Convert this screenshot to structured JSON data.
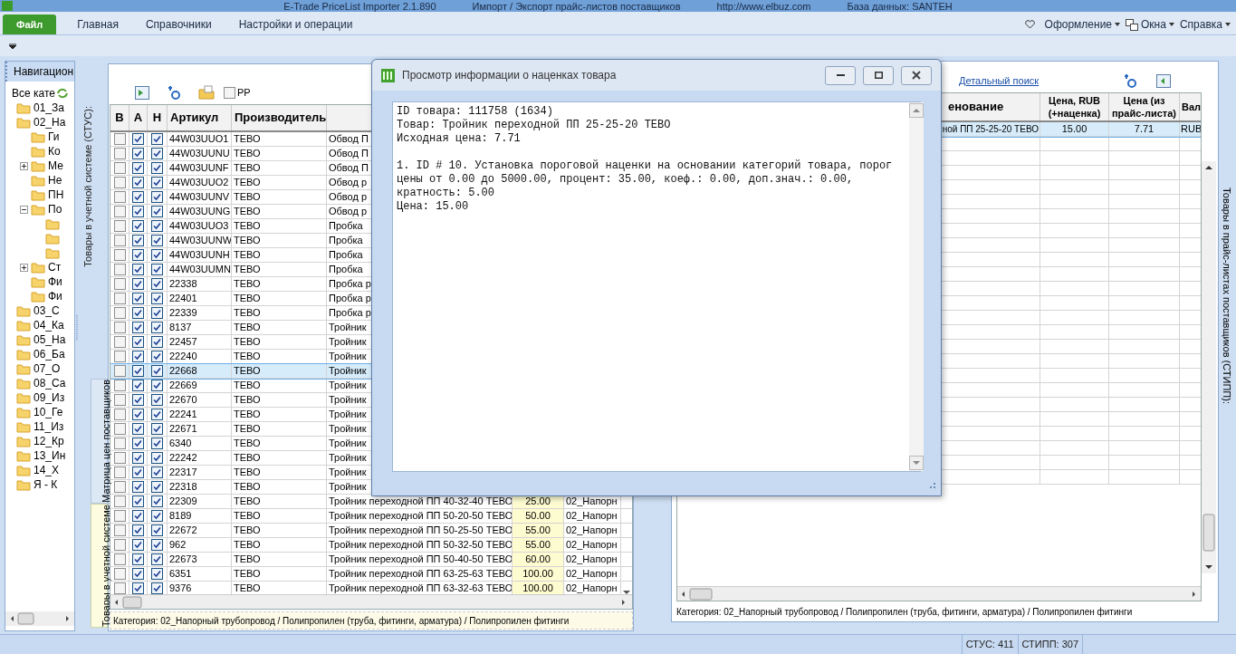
{
  "window": {
    "title_parts": [
      "E-Trade PriceList Importer 2.1.890",
      "Импорт / Экспорт прайс-листов поставщиков",
      "http://www.elbuz.com",
      "База данных: SANTEH"
    ]
  },
  "ribbon": {
    "tabs": [
      {
        "label": "Файл",
        "selected": true
      },
      {
        "label": "Главная",
        "selected": false
      },
      {
        "label": "Справочники",
        "selected": false
      },
      {
        "label": "Настройки и операции",
        "selected": false
      }
    ],
    "menus": [
      {
        "label": "Оформление"
      },
      {
        "label": "Окна"
      },
      {
        "label": "Справка"
      }
    ]
  },
  "navigation": {
    "title": "Навигацион",
    "root": "Все кате",
    "tree": [
      {
        "label": "01_За"
      },
      {
        "label": "02_На",
        "children": [
          {
            "label": "Ги"
          },
          {
            "label": "Ко"
          },
          {
            "label": "Ме",
            "expanded": false
          },
          {
            "label": "Не"
          },
          {
            "label": "ПН"
          },
          {
            "label": "По",
            "expanded": true,
            "children": [
              {
                "kind": "folder"
              },
              {
                "kind": "folder"
              },
              {
                "kind": "folder"
              }
            ]
          },
          {
            "label": "Ст",
            "expanded": false
          },
          {
            "label": "Фи"
          },
          {
            "label": "Фи"
          }
        ]
      },
      {
        "label": "03_С"
      },
      {
        "label": "04_Ка"
      },
      {
        "label": "05_На"
      },
      {
        "label": "06_Ба"
      },
      {
        "label": "07_О"
      },
      {
        "label": "08_Са"
      },
      {
        "label": "09_Из"
      },
      {
        "label": "10_Ге"
      },
      {
        "label": "11_Из"
      },
      {
        "label": "12_Кр"
      },
      {
        "label": "13_Ин"
      },
      {
        "label": "14_Х"
      },
      {
        "label": "Я - К"
      }
    ]
  },
  "side_tabs": {
    "caption": "Товары в учетной системе (СТУС):",
    "tabs": [
      {
        "label": "Матрица цен поставщиков",
        "selected": false
      },
      {
        "label": "Товары в учетной системе",
        "selected": true
      }
    ]
  },
  "left_toolbar": {
    "checkbox": {
      "label": "РР",
      "checked": false
    }
  },
  "left_table": {
    "columns": [
      "В",
      "А",
      "Н",
      "Артикул",
      "Производитель"
    ],
    "rows": [
      {
        "b": false,
        "a": true,
        "h": true,
        "article": "44W03UUO1",
        "maker": "ТЕВО",
        "name": "Обвод П",
        "selected": false
      },
      {
        "b": false,
        "a": true,
        "h": true,
        "article": "44W03UUNU",
        "maker": "ТЕВО",
        "name": "Обвод П",
        "selected": false
      },
      {
        "b": false,
        "a": true,
        "h": true,
        "article": "44W03UUNF",
        "maker": "ТЕВО",
        "name": "Обвод П",
        "selected": false
      },
      {
        "b": false,
        "a": true,
        "h": true,
        "article": "44W03UUO2",
        "maker": "ТЕВО",
        "name": "Обвод р",
        "selected": false
      },
      {
        "b": false,
        "a": true,
        "h": true,
        "article": "44W03UUNV",
        "maker": "ТЕВО",
        "name": "Обвод р",
        "selected": false
      },
      {
        "b": false,
        "a": true,
        "h": true,
        "article": "44W03UUNG",
        "maker": "ТЕВО",
        "name": "Обвод р",
        "selected": false
      },
      {
        "b": false,
        "a": true,
        "h": true,
        "article": "44W03UUO3",
        "maker": "ТЕВО",
        "name": "Пробка",
        "selected": false
      },
      {
        "b": false,
        "a": true,
        "h": true,
        "article": "44W03UUNW",
        "maker": "ТЕВО",
        "name": "Пробка",
        "selected": false
      },
      {
        "b": false,
        "a": true,
        "h": true,
        "article": "44W03UUNH",
        "maker": "ТЕВО",
        "name": "Пробка",
        "selected": false
      },
      {
        "b": false,
        "a": true,
        "h": true,
        "article": "44W03UUMN",
        "maker": "ТЕВО",
        "name": "Пробка",
        "selected": false
      },
      {
        "b": false,
        "a": true,
        "h": true,
        "article": "22338",
        "maker": "ТЕВО",
        "name": "Пробка р",
        "selected": false
      },
      {
        "b": false,
        "a": true,
        "h": true,
        "article": "22401",
        "maker": "ТЕВО",
        "name": "Пробка р",
        "selected": false
      },
      {
        "b": false,
        "a": true,
        "h": true,
        "article": "22339",
        "maker": "ТЕВО",
        "name": "Пробка р",
        "selected": false
      },
      {
        "b": false,
        "a": true,
        "h": true,
        "article": "8137",
        "maker": "ТЕВО",
        "name": "Тройник",
        "selected": false
      },
      {
        "b": false,
        "a": true,
        "h": true,
        "article": "22457",
        "maker": "ТЕВО",
        "name": "Тройник",
        "selected": false
      },
      {
        "b": false,
        "a": true,
        "h": true,
        "article": "22240",
        "maker": "ТЕВО",
        "name": "Тройник",
        "selected": false
      },
      {
        "b": false,
        "a": true,
        "h": true,
        "article": "22668",
        "maker": "ТЕВО",
        "name": "Тройник",
        "selected": true
      },
      {
        "b": false,
        "a": true,
        "h": true,
        "article": "22669",
        "maker": "ТЕВО",
        "name": "Тройник",
        "selected": false
      },
      {
        "b": false,
        "a": true,
        "h": true,
        "article": "22670",
        "maker": "ТЕВО",
        "name": "Тройник",
        "selected": false
      },
      {
        "b": false,
        "a": true,
        "h": true,
        "article": "22241",
        "maker": "ТЕВО",
        "name": "Тройник",
        "selected": false
      },
      {
        "b": false,
        "a": true,
        "h": true,
        "article": "22671",
        "maker": "ТЕВО",
        "name": "Тройник",
        "selected": false
      },
      {
        "b": false,
        "a": true,
        "h": true,
        "article": "6340",
        "maker": "ТЕВО",
        "name": "Тройник",
        "selected": false
      },
      {
        "b": false,
        "a": true,
        "h": true,
        "article": "22242",
        "maker": "ТЕВО",
        "name": "Тройник",
        "selected": false
      },
      {
        "b": false,
        "a": true,
        "h": true,
        "article": "22317",
        "maker": "ТЕВО",
        "name": "Тройник",
        "selected": false
      },
      {
        "b": false,
        "a": true,
        "h": true,
        "article": "22318",
        "maker": "ТЕВО",
        "name": "Тройник",
        "selected": false
      },
      {
        "b": false,
        "a": true,
        "h": true,
        "article": "22309",
        "maker": "ТЕВО",
        "name": "Тройник переходной ПП 40-32-40 ТЕВО",
        "price": "25.00",
        "category": "02_Напорн",
        "selected": false
      },
      {
        "b": false,
        "a": true,
        "h": true,
        "article": "8189",
        "maker": "ТЕВО",
        "name": "Тройник переходной ПП 50-20-50 ТЕВО",
        "price": "50.00",
        "category": "02_Напорн",
        "selected": false
      },
      {
        "b": false,
        "a": true,
        "h": true,
        "article": "22672",
        "maker": "ТЕВО",
        "name": "Тройник переходной ПП 50-25-50 ТЕВО",
        "price": "55.00",
        "category": "02_Напорн",
        "selected": false
      },
      {
        "b": false,
        "a": true,
        "h": true,
        "article": "962",
        "maker": "ТЕВО",
        "name": "Тройник переходной ПП 50-32-50 ТЕВО",
        "price": "55.00",
        "category": "02_Напорн",
        "selected": false
      },
      {
        "b": false,
        "a": true,
        "h": true,
        "article": "22673",
        "maker": "ТЕВО",
        "name": "Тройник переходной ПП 50-40-50 ТЕВО",
        "price": "60.00",
        "category": "02_Напорн",
        "selected": false
      },
      {
        "b": false,
        "a": true,
        "h": true,
        "article": "6351",
        "maker": "ТЕВО",
        "name": "Тройник переходной ПП 63-25-63 ТЕВО",
        "price": "100.00",
        "category": "02_Напорн",
        "selected": false
      },
      {
        "b": false,
        "a": true,
        "h": true,
        "article": "9376",
        "maker": "ТЕВО",
        "name": "Тройник переходной ПП 63-32-63 ТЕВО",
        "price": "100.00",
        "category": "02_Напорн",
        "selected": false
      }
    ],
    "category_line": "Категория: 02_Напорный трубопровод / Полипропилен (труба, фитинги, арматура) / Полипропилен фитинги"
  },
  "right_panel": {
    "search_link": "Детальный поиск",
    "side_caption": "Товары в прайс-листах поставщиков (СТИПП):",
    "columns": [
      "енование",
      "Цена, RUB (+наценка)",
      "Цена (из прайс-листа)",
      "Вал"
    ],
    "rows": [
      {
        "name": "ной ПП 25-25-20 ТЕВО",
        "price": "15.00",
        "source_price": "7.71",
        "currency": "RUB",
        "selected": true
      }
    ],
    "category_line": "Категория: 02_Напорный трубопровод / Полипропилен (труба, фитинги, арматура) / Полипропилен фитинги"
  },
  "dialog": {
    "title": "Просмотр информации о наценках товара",
    "paragraphs": [
      [
        "ID товара: 111758 (1634)",
        "Товар: Тройник переходной ПП 25-25-20 ТЕВО",
        "Исходная цена: 7.71"
      ],
      [
        "1. ID # 10. Установка пороговой наценки на основании категорий товара, порог цены от 0.00 до 5000.00, процент: 35.00, коеф.: 0.00, доп.знач.: 0.00, кратность: 5.00",
        "Цена: 15.00"
      ]
    ]
  },
  "status_bar": [
    "СТУС: 411",
    "СТИПП: 307"
  ]
}
